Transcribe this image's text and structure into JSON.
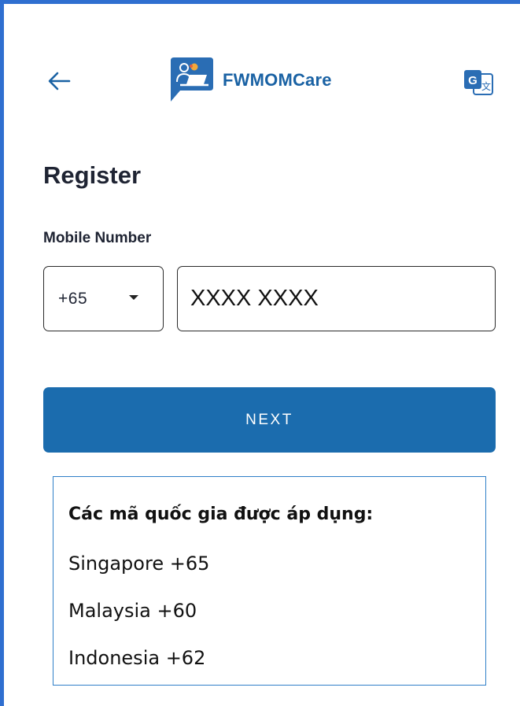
{
  "header": {
    "brand_name": "FWMOMCare",
    "back_icon": "arrow-left-icon",
    "translate_icon": "translate-icon",
    "logo_icon": "fwmomcare-logo-icon",
    "brand_color": "#1a62a4"
  },
  "page": {
    "title": "Register"
  },
  "form": {
    "mobile_label": "Mobile Number",
    "country_code": "+65",
    "phone_placeholder": "XXXX XXXX",
    "next_label": "NEXT",
    "button_color": "#1b6cae"
  },
  "info": {
    "title": "Các mã quốc gia được áp dụng:",
    "countries": [
      "Singapore +65",
      "Malaysia +60",
      "Indonesia +62"
    ]
  }
}
